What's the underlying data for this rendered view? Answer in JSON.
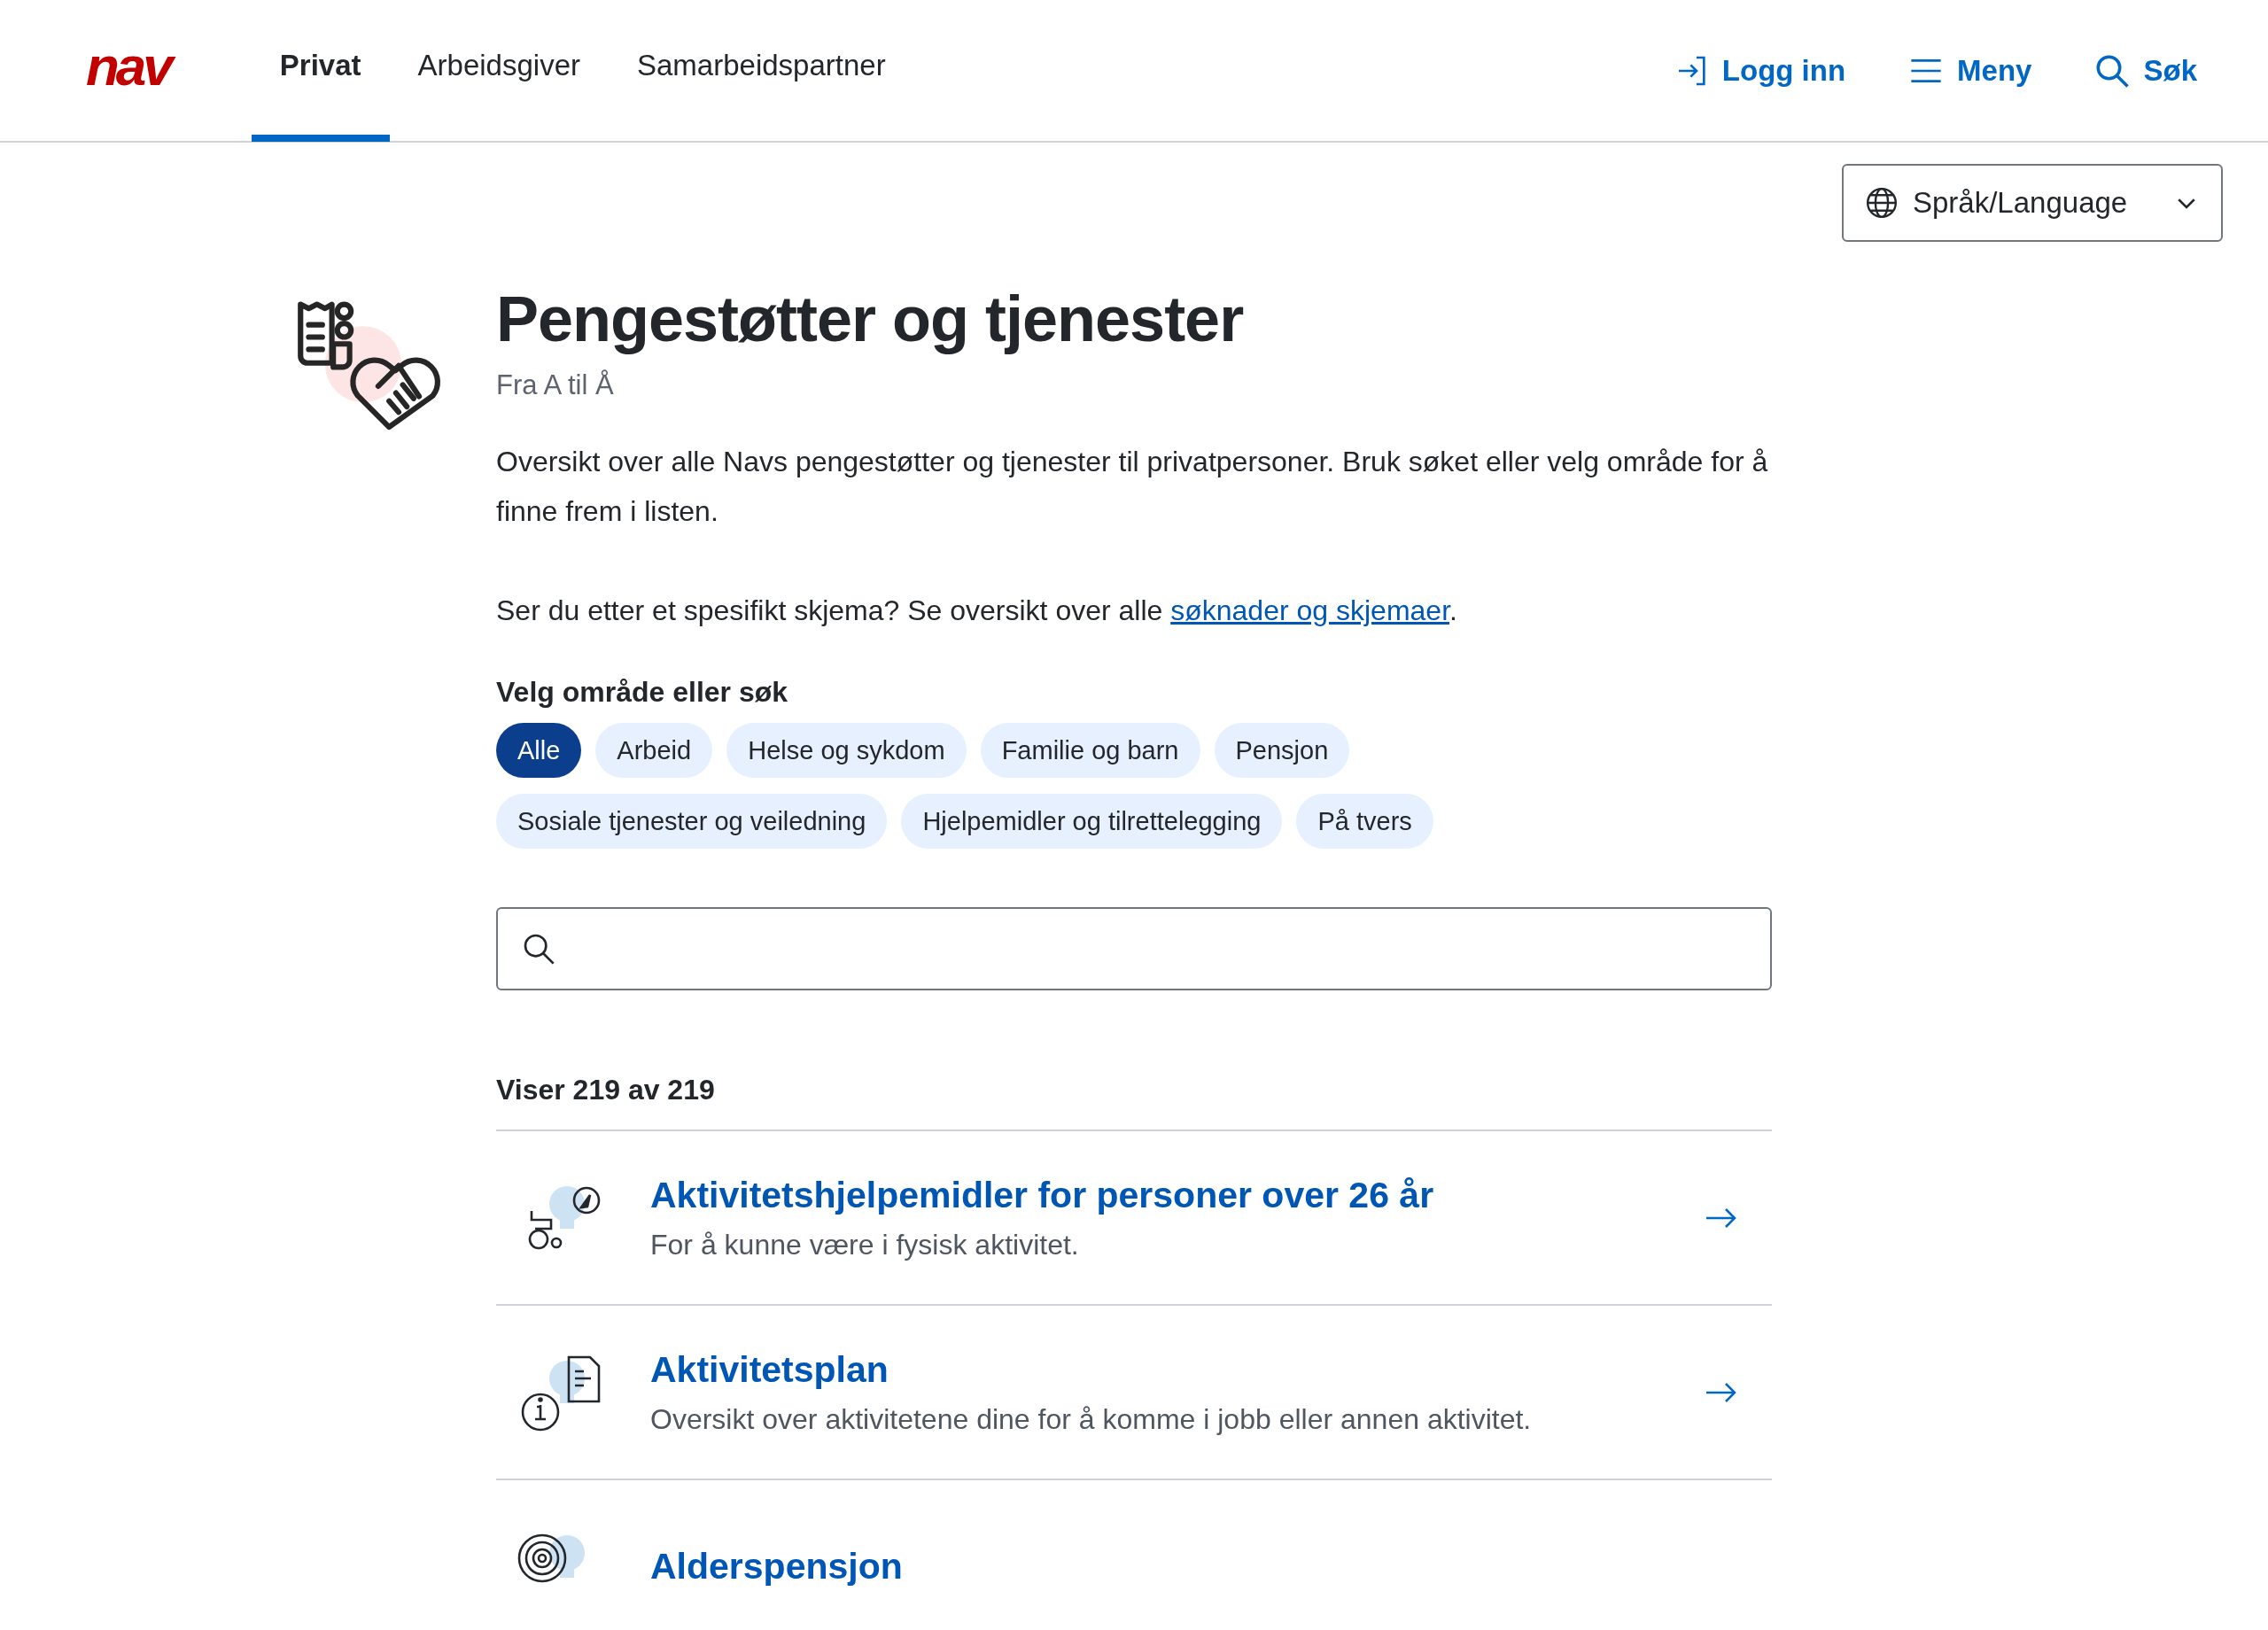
{
  "header": {
    "logo": "nav",
    "tabs": [
      {
        "label": "Privat",
        "selected": true
      },
      {
        "label": "Arbeidsgiver",
        "selected": false
      },
      {
        "label": "Samarbeidspartner",
        "selected": false
      }
    ],
    "actions": [
      {
        "kind": "login",
        "label": "Logg inn"
      },
      {
        "kind": "menu",
        "label": "Meny"
      },
      {
        "kind": "search",
        "label": "Søk"
      }
    ]
  },
  "language": {
    "label": "Språk/Language"
  },
  "page": {
    "title": "Pengestøtter og tjenester",
    "subtitle": "Fra A til Å",
    "intro": "Oversikt over alle Navs pengestøtter og tjenester til privatpersoner. Bruk søket eller velg område for å finne frem i listen.",
    "forms_text": "Ser du etter et spesifikt skjema? Se oversikt over alle ",
    "forms_link": "søknader og skjemaer",
    "forms_end": "."
  },
  "filter": {
    "label": "Velg område eller søk",
    "chips": [
      {
        "label": "Alle",
        "selected": true
      },
      {
        "label": "Arbeid",
        "selected": false
      },
      {
        "label": "Helse og sykdom",
        "selected": false
      },
      {
        "label": "Familie og barn",
        "selected": false
      },
      {
        "label": "Pensjon",
        "selected": false
      },
      {
        "label": "Sosiale tjenester og veiledning",
        "selected": false
      },
      {
        "label": "Hjelpemidler og tilrettelegging",
        "selected": false
      },
      {
        "label": "På tvers",
        "selected": false
      }
    ]
  },
  "results": {
    "count": "Viser 219 av 219",
    "items": [
      {
        "kind": "wheelchair",
        "title": "Aktivitetshjelpemidler for personer over 26 år",
        "description": "For å kunne være i fysisk aktivitet."
      },
      {
        "kind": "document",
        "title": "Aktivitetsplan",
        "description": "Oversikt over aktivitetene dine for å komme i jobb eller annen aktivitet."
      },
      {
        "kind": "target",
        "title": "Alderspensjon"
      }
    ]
  }
}
